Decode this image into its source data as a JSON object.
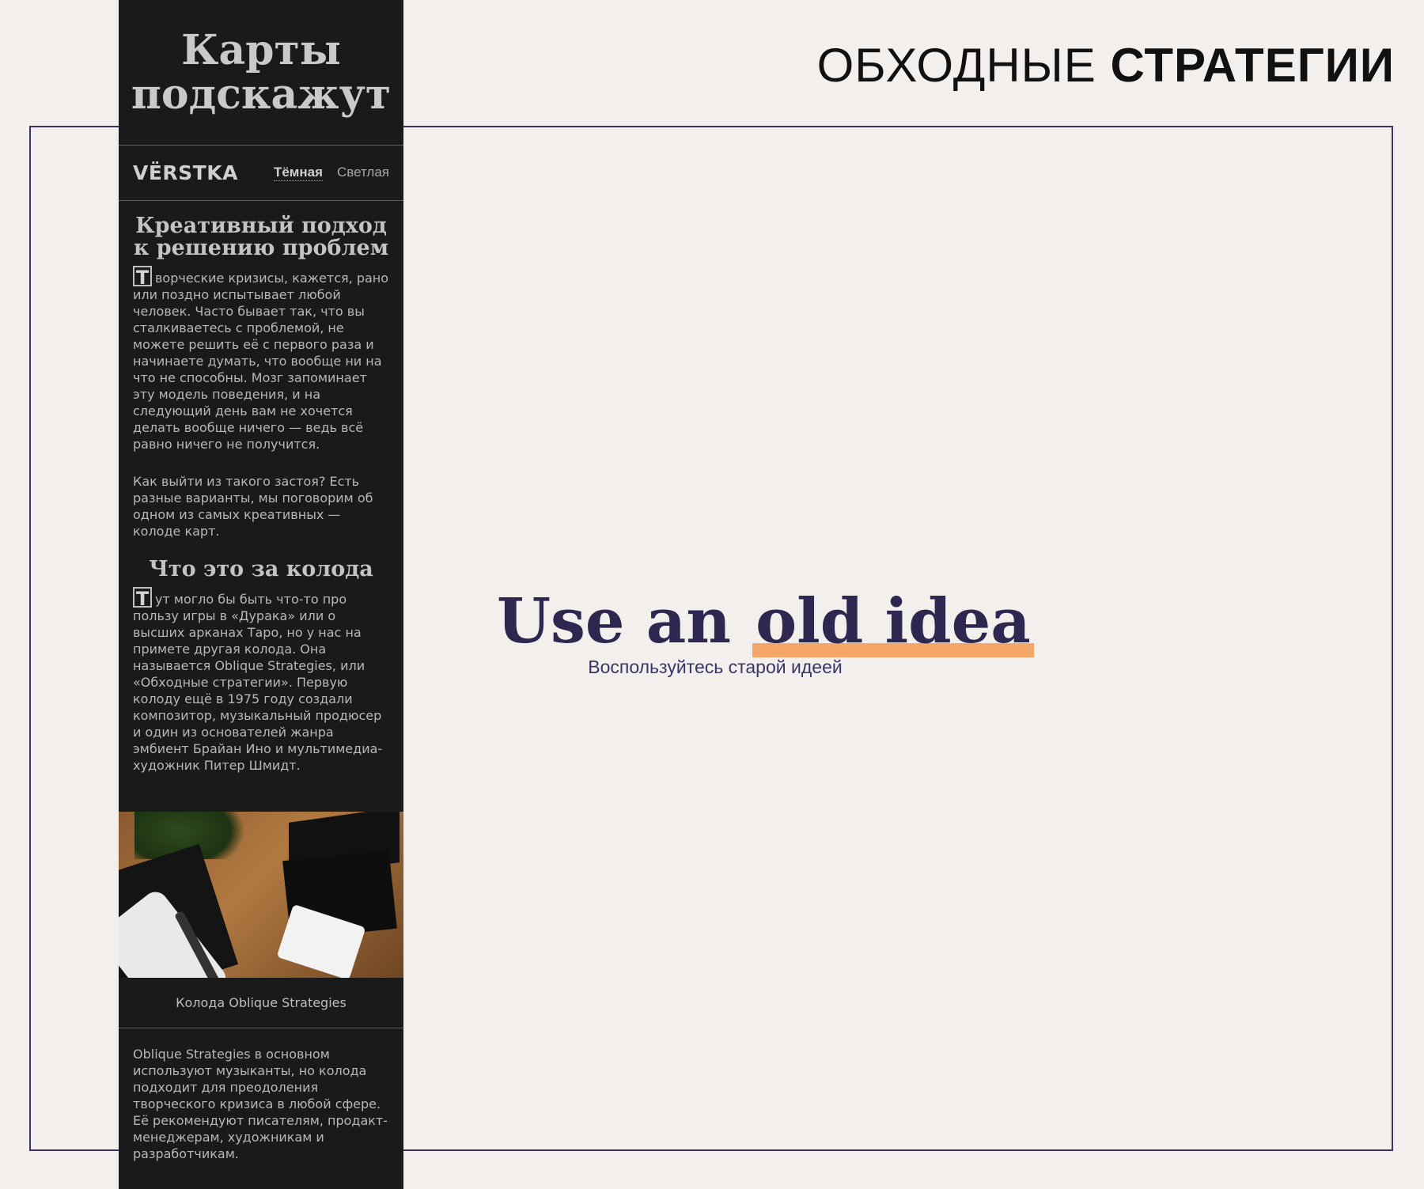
{
  "header": {
    "title_light": "ОБХОДНЫЕ",
    "title_bold": "СТРАТЕГИИ"
  },
  "phone": {
    "title": "Карты подскажут",
    "logo": "VЁRSTKA",
    "theme": {
      "dark_label": "Тёмная",
      "light_label": "Светлая",
      "selected": "Тёмная"
    },
    "section1": {
      "heading": "Креативный подход к решению проблем",
      "dropcap": "Т",
      "paragraph1": "ворческие кризисы, кажется, рано или поздно испытывает любой человек. Часто бывает так, что вы сталкиваетесь с проблемой, не можете решить её с первого раза и начинаете думать, что вообще ни на что не способны. Мозг запоминает эту модель поведения, и на следующий день вам не хочется делать вообще ничего — ведь всё равно ничего не получится.",
      "paragraph2": "Как выйти из такого застоя? Есть разные варианты, мы поговорим об одном из самых креативных — колоде карт."
    },
    "section2": {
      "heading": "Что это за колода",
      "dropcap": "Т",
      "paragraph1": "ут могло бы быть что-то про пользу игры в «Дурака» или о высших арканах Таро, но у нас на примете другая колода. Она называется Oblique Strategies, или «Обходные стратегии». Первую колоду ещё в 1975 году создали композитор, музыкальный продюсер и один из основателей жанра эмбиент Брайан Ино и мультимедиа-художник Питер Шмидт."
    },
    "photo_caption": "Колода Oblique Strategies",
    "paragraph_after": "Oblique Strategies в основном используют музыканты, но колода подходит для преодоления творческого кризиса в любой сфере. Её рекомендуют писателям, продакт-менеджерам, художникам и разработчикам."
  },
  "card": {
    "phrase_plain": "Use an",
    "phrase_highlight": "old idea",
    "translation": "Воспользуйтесь старой идеей"
  },
  "colors": {
    "background": "#f3efec",
    "phone_bg": "#1a1a1a",
    "accent": "#2e2750",
    "highlight": "#f4a769",
    "frame": "#3b3466"
  }
}
